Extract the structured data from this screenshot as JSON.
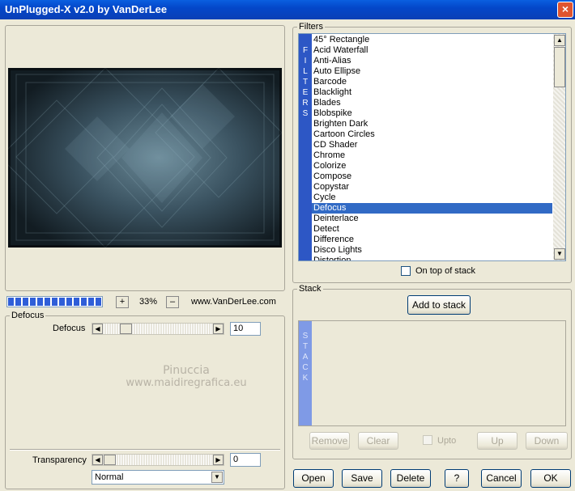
{
  "window": {
    "title": "UnPlugged-X v2.0 by VanDerLee",
    "close": "×"
  },
  "preview": {
    "zoom_in": "+",
    "zoom_value": "33%",
    "zoom_out": "–",
    "website": "www.VanDerLee.com"
  },
  "filters": {
    "group_label": "Filters",
    "tab_letters": "FILTERS",
    "items": [
      "45° Rectangle",
      "Acid Waterfall",
      "Anti-Alias",
      "Auto Ellipse",
      "Barcode",
      "Blacklight",
      "Blades",
      "Blobspike",
      "Brighten Dark",
      "Cartoon Circles",
      "CD Shader",
      "Chrome",
      "Colorize",
      "Compose",
      "Copystar",
      "Cycle",
      "Defocus",
      "Deinterlace",
      "Detect",
      "Difference",
      "Disco Lights",
      "Distortion"
    ],
    "selected": "Defocus",
    "on_top_label": "On top of stack"
  },
  "stack": {
    "group_label": "Stack",
    "add_button": "Add to stack",
    "tab_letters": "STACK",
    "remove": "Remove",
    "clear": "Clear",
    "upto": "Upto",
    "up": "Up",
    "down": "Down"
  },
  "params": {
    "group_label": "Defocus",
    "defocus_label": "Defocus",
    "defocus_value": "10",
    "defocus_level": 0.17,
    "watermark_line1": "Pinuccia",
    "watermark_line2": "www.maidiregrafica.eu"
  },
  "transparency": {
    "label": "Transparency",
    "value": "0",
    "blend_mode": "Normal"
  },
  "footer": {
    "open": "Open",
    "save": "Save",
    "delete": "Delete",
    "help": "?",
    "cancel": "Cancel",
    "ok": "OK"
  }
}
